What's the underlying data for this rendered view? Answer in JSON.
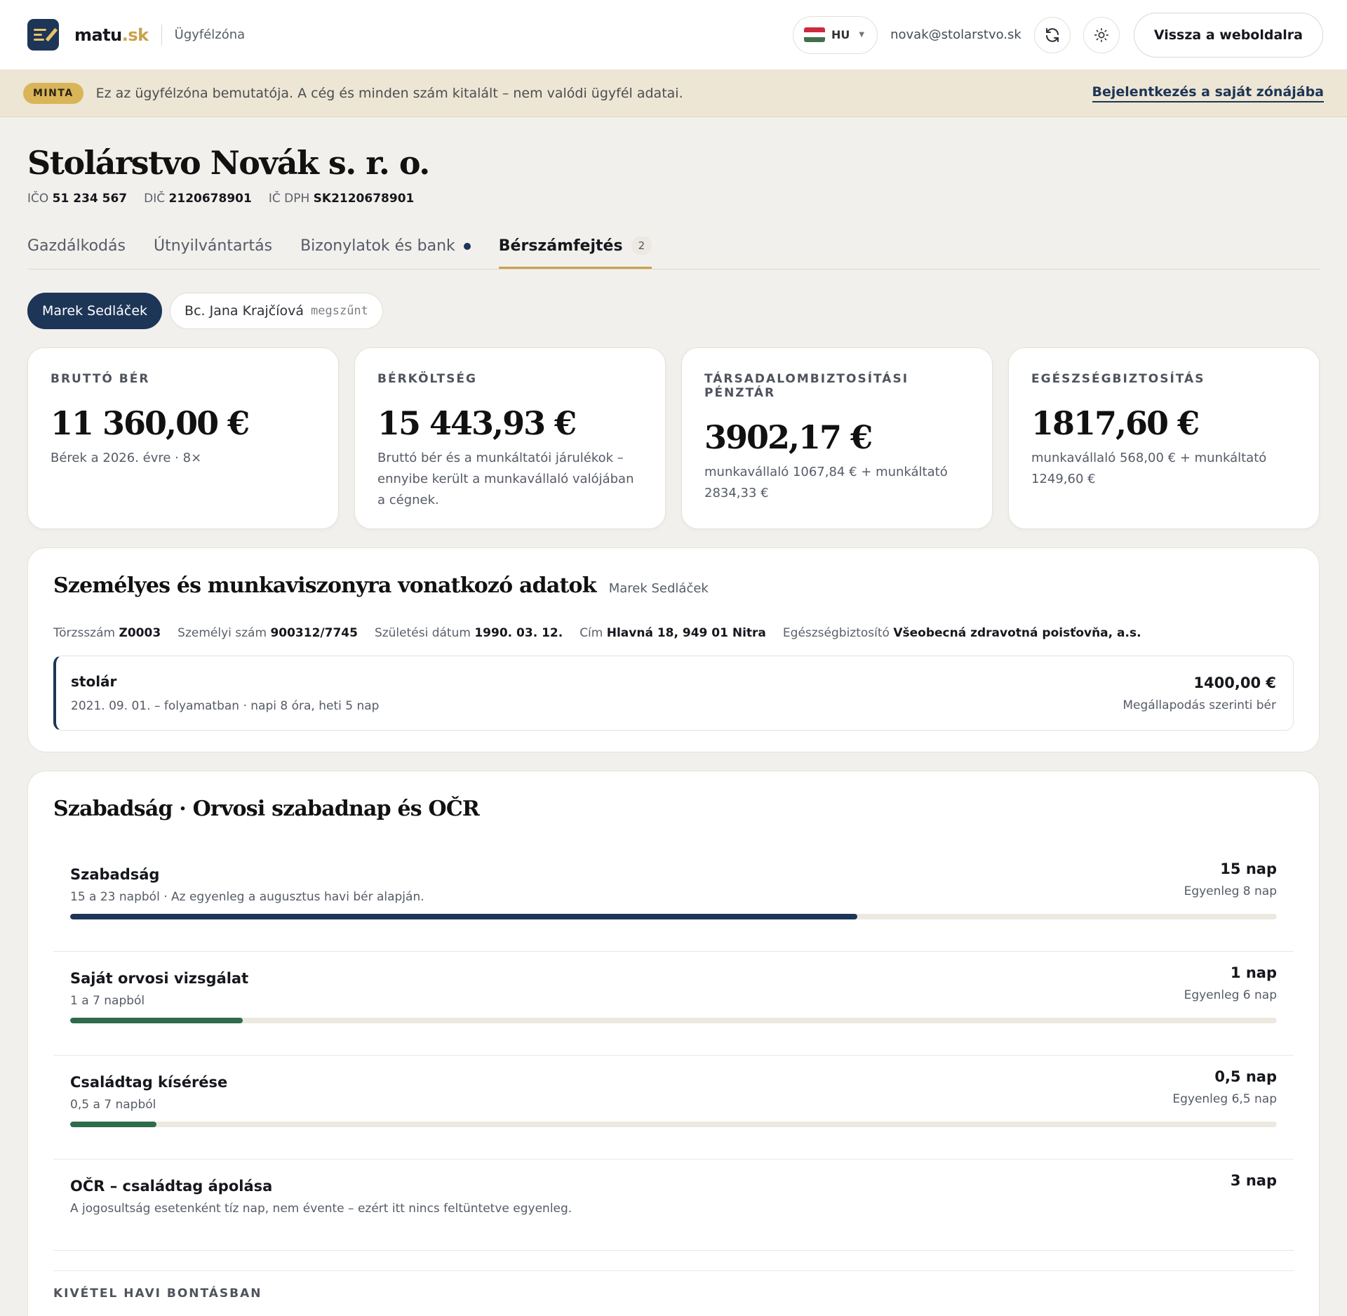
{
  "header": {
    "brand_main": "matu",
    "brand_dot": ".sk",
    "subtitle": "Ügyfélzóna",
    "lang": "HU",
    "email": "novak@stolarstvo.sk",
    "back_button": "Vissza a weboldalra",
    "icons": [
      "refresh-icon",
      "sun-icon",
      "chevron-down-icon"
    ]
  },
  "banner": {
    "badge": "MINTA",
    "text": "Ez az ügyfélzóna bemutatója. A cég és minden szám kitalált – nem valódi ügyfél adatai.",
    "link": "Bejelentkezés a saját zónájába"
  },
  "company": {
    "name": "Stolárstvo Novák s. r. o.",
    "ico_label": "IČO",
    "ico": "51 234 567",
    "dic_label": "DIČ",
    "dic": "2120678901",
    "icdph_label": "IČ DPH",
    "icdph": "SK2120678901"
  },
  "tabs": [
    {
      "label": "Gazdálkodás"
    },
    {
      "label": "Útnyilvántartás"
    },
    {
      "label": "Bizonylatok és bank"
    },
    {
      "label": "Bérszámfejtés",
      "count": "2"
    }
  ],
  "employees": [
    {
      "name": "Marek Sedláček"
    },
    {
      "name": "Bc. Jana Krajčíová",
      "status": "megszűnt"
    }
  ],
  "cards": [
    {
      "label": "BRUTTÓ BÉR",
      "value": "11 360,00 €",
      "sub": "Bérek a 2026. évre · 8×"
    },
    {
      "label": "BÉRKÖLTSÉG",
      "value": "15 443,93 €",
      "sub": "Bruttó bér és a munkáltatói járulékok – ennyibe került a munkavállaló valójában a cégnek."
    },
    {
      "label": "TÁRSADALOMBIZTOSÍTÁSI PÉNZTÁR",
      "value": "3902,17 €",
      "sub": "munkavállaló 1067,84 € + munkáltató 2834,33 €"
    },
    {
      "label": "EGÉSZSÉGBIZTOSÍTÁS",
      "value": "1817,60 €",
      "sub": "munkavállaló 568,00 € + munkáltató 1249,60 €"
    }
  ],
  "personal": {
    "title": "Személyes és munkaviszonyra vonatkozó adatok",
    "employee": "Marek Sedláček",
    "facts": [
      {
        "label": "Törzsszám",
        "value": "Z0003"
      },
      {
        "label": "Személyi szám",
        "value": "900312/7745"
      },
      {
        "label": "Születési dátum",
        "value": "1990. 03. 12."
      },
      {
        "label": "Cím",
        "value": "Hlavná 18, 949 01 Nitra"
      },
      {
        "label": "Egészségbiztosító",
        "value": "Všeobecná zdravotná poisťovňa, a.s."
      }
    ],
    "job": {
      "title": "stolár",
      "meta": "2021. 09. 01. – folyamatban · napi 8 óra, heti 5 nap",
      "amount": "1400,00 €",
      "note": "Megállapodás szerinti bér"
    }
  },
  "leave": {
    "title": "Szabadság · Orvosi szabadnap és OČR",
    "items": [
      {
        "name": "Szabadság",
        "desc": "15 a 23 napból · Az egyenleg a augusztus havi bér alapján.",
        "days": "15 nap",
        "balance": "Egyenleg 8 nap",
        "used": 15,
        "total": 23,
        "color": "#1d3557"
      },
      {
        "name": "Saját orvosi vizsgálat",
        "desc": "1 a 7 napból",
        "days": "1 nap",
        "balance": "Egyenleg 6 nap",
        "used": 1,
        "total": 7,
        "color": "#2e6b4a"
      },
      {
        "name": "Családtag kísérése",
        "desc": "0,5 a 7 napból",
        "days": "0,5 nap",
        "balance": "Egyenleg 6,5 nap",
        "used": 0.5,
        "total": 7,
        "color": "#2e6b4a"
      },
      {
        "name": "OČR – családtag ápolása",
        "desc": "A jogosultság esetenként tíz nap, nem évente – ezért itt nincs feltüntetve egyenleg.",
        "days": "3 nap"
      }
    ],
    "monthly_label": "KIVÉTEL HAVI BONTÁSBAN"
  },
  "colors": {
    "accent_navy": "#1d3557",
    "accent_gold": "#c9a24a",
    "leave_green": "#2e6b4a"
  }
}
